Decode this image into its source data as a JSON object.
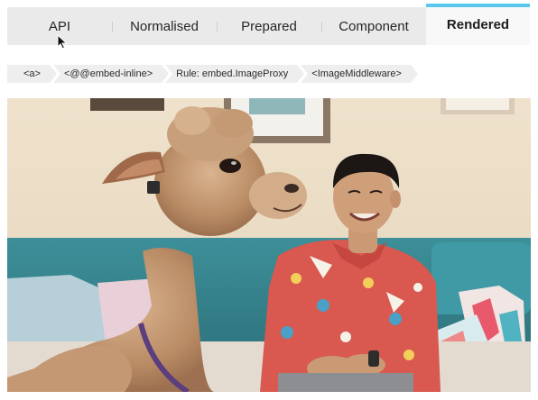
{
  "tabs": [
    {
      "label": "API",
      "active": false
    },
    {
      "label": "Normalised",
      "active": false
    },
    {
      "label": "Prepared",
      "active": false
    },
    {
      "label": "Component",
      "active": false
    },
    {
      "label": "Rendered",
      "active": true
    }
  ],
  "breadcrumb": [
    {
      "label": "<a>"
    },
    {
      "label": "<@@embed-inline>"
    },
    {
      "label": "Rule: embed.ImageProxy"
    },
    {
      "label": "<ImageMiddleware>"
    }
  ],
  "colors": {
    "accent": "#5ac8ec",
    "tab_bar": "#eaeaea",
    "active_tab": "#f8f8f8",
    "breadcrumb_bg": "#eeeeee"
  },
  "rendered_image": {
    "subject": "alpaca-and-man-on-couch-photo"
  },
  "icons": {
    "cursor": "mouse-pointer-icon"
  }
}
